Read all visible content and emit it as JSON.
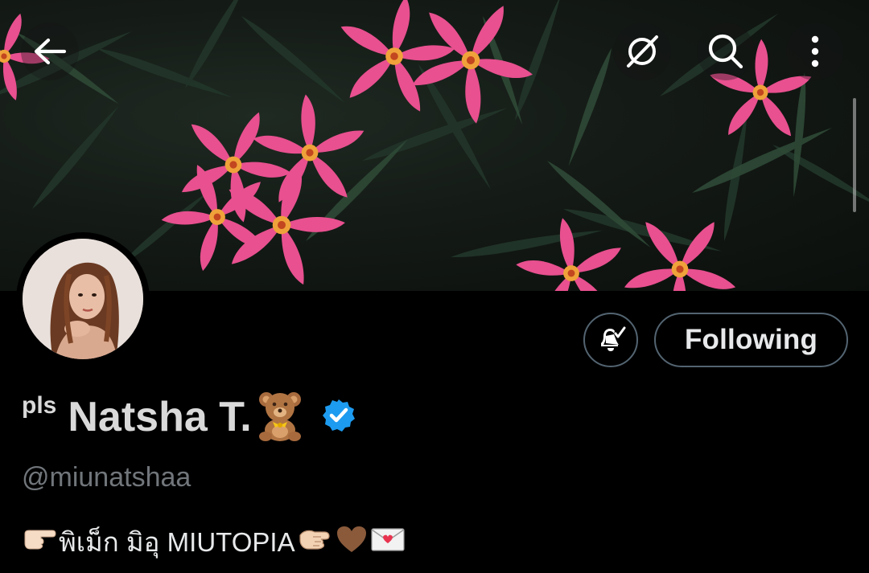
{
  "header": {
    "back_icon": "arrow-left-icon",
    "translate_icon": "grok-icon",
    "search_icon": "search-icon",
    "more_icon": "more-vertical-icon"
  },
  "banner": {
    "description_icon": "pink-oleander-flowers-photo"
  },
  "profile": {
    "name_prefix": "pls",
    "display_name": "Natsha T.",
    "name_emoji": "teddy-bear-icon",
    "verified_icon": "verified-badge-icon",
    "handle": "@miunatshaa",
    "bio_text": "พิเม็ก มิอุ MIUTOPIA"
  },
  "actions": {
    "notify_icon": "bell-check-icon",
    "following_label": "Following"
  },
  "colors": {
    "background": "#000000",
    "text_primary": "#e7e9ea",
    "text_secondary": "#71767b",
    "border": "#536471",
    "verified_blue": "#1d9bf0",
    "flower_pink": "#e84f8f"
  }
}
